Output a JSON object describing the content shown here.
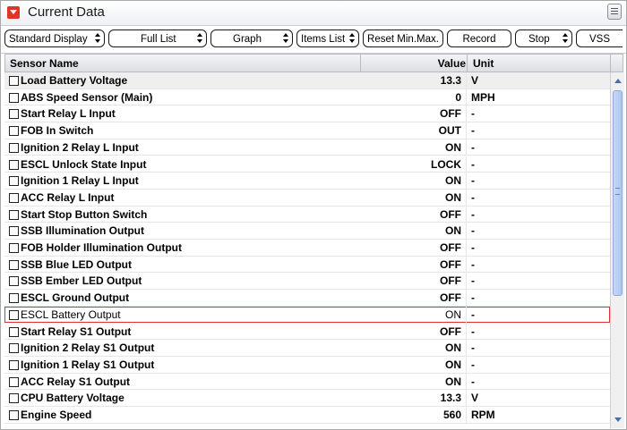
{
  "window": {
    "title": "Current Data"
  },
  "toolbar": {
    "display_mode": "Standard Display",
    "list_mode": "Full List",
    "view_mode": "Graph",
    "items_list": "Items List",
    "reset_label": "Reset Min.Max.",
    "record_label": "Record",
    "stop_label": "Stop",
    "vss_label": "VSS"
  },
  "table": {
    "headers": {
      "name": "Sensor Name",
      "value": "Value",
      "unit": "Unit"
    },
    "rows": [
      {
        "name": "Load Battery Voltage",
        "value": "13.3",
        "unit": "V"
      },
      {
        "name": "ABS Speed Sensor (Main)",
        "value": "0",
        "unit": "MPH"
      },
      {
        "name": "Start Relay L Input",
        "value": "OFF",
        "unit": "-"
      },
      {
        "name": "FOB In Switch",
        "value": "OUT",
        "unit": "-"
      },
      {
        "name": "Ignition 2 Relay L Input",
        "value": "ON",
        "unit": "-"
      },
      {
        "name": "ESCL Unlock State Input",
        "value": "LOCK",
        "unit": "-"
      },
      {
        "name": "Ignition 1 Relay L Input",
        "value": "ON",
        "unit": "-"
      },
      {
        "name": "ACC Relay L Input",
        "value": "ON",
        "unit": "-"
      },
      {
        "name": "Start Stop Button Switch",
        "value": "OFF",
        "unit": "-"
      },
      {
        "name": "SSB Illumination Output",
        "value": "ON",
        "unit": "-"
      },
      {
        "name": "FOB Holder Illumination Output",
        "value": "OFF",
        "unit": "-"
      },
      {
        "name": "SSB Blue LED Output",
        "value": "OFF",
        "unit": "-"
      },
      {
        "name": "SSB Ember LED Output",
        "value": "OFF",
        "unit": "-"
      },
      {
        "name": "ESCL Ground Output",
        "value": "OFF",
        "unit": "-"
      },
      {
        "name": "ESCL Battery Output",
        "value": "ON",
        "unit": "-"
      },
      {
        "name": "Start Relay S1 Output",
        "value": "OFF",
        "unit": "-"
      },
      {
        "name": "Ignition 2 Relay S1 Output",
        "value": "ON",
        "unit": "-"
      },
      {
        "name": "Ignition 1 Relay S1 Output",
        "value": "ON",
        "unit": "-"
      },
      {
        "name": "ACC Relay S1 Output",
        "value": "ON",
        "unit": "-"
      },
      {
        "name": "CPU Battery Voltage",
        "value": "13.3",
        "unit": "V"
      },
      {
        "name": "Engine Speed",
        "value": "560",
        "unit": "RPM"
      }
    ]
  },
  "selected_row": "ESCL Battery Output",
  "colors": {
    "accent": "#e0342b",
    "selection_outline": "#e03030",
    "scroll_thumb": "#aec6ee"
  },
  "icons": {
    "collapse": "collapse-red-icon",
    "menu": "list-menu-icon"
  }
}
